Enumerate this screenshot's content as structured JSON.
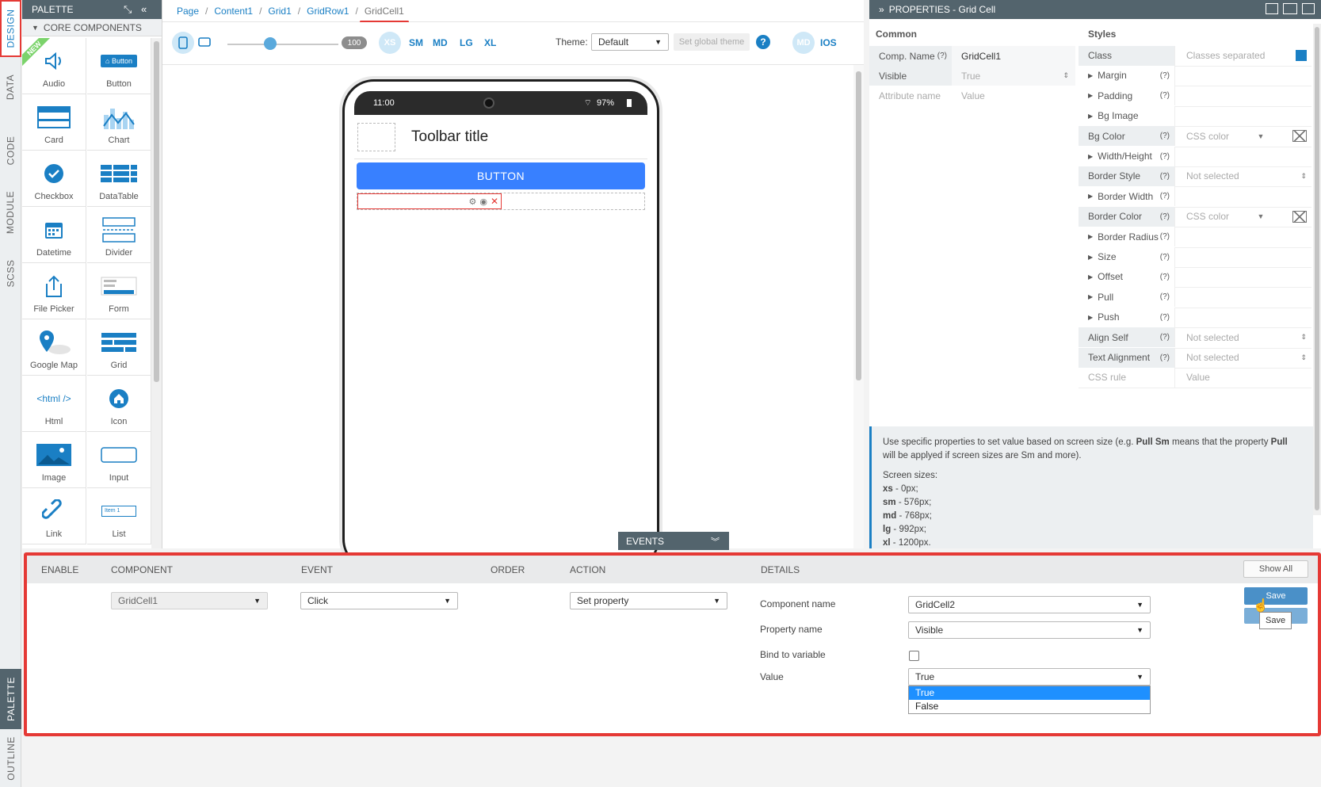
{
  "left_tabs": [
    "DESIGN",
    "DATA",
    "CODE",
    "MODULE",
    "SCSS",
    "PALETTE",
    "OUTLINE"
  ],
  "palette": {
    "title": "PALETTE",
    "section": "CORE COMPONENTS",
    "new_badge": "NEW",
    "items": [
      {
        "label": "Audio",
        "icon": "speaker-icon"
      },
      {
        "label": "Button",
        "icon": "button-icon",
        "mini": "Button"
      },
      {
        "label": "Card",
        "icon": "card-icon"
      },
      {
        "label": "Chart",
        "icon": "chart-icon"
      },
      {
        "label": "Checkbox",
        "icon": "checkbox-icon"
      },
      {
        "label": "DataTable",
        "icon": "datatable-icon"
      },
      {
        "label": "Datetime",
        "icon": "calendar-icon"
      },
      {
        "label": "Divider",
        "icon": "divider-icon"
      },
      {
        "label": "File Picker",
        "icon": "upload-icon"
      },
      {
        "label": "Form",
        "icon": "form-icon"
      },
      {
        "label": "Google Map",
        "icon": "map-pin-icon"
      },
      {
        "label": "Grid",
        "icon": "grid-icon"
      },
      {
        "label": "Html",
        "icon": "html-icon",
        "mini": "<html />"
      },
      {
        "label": "Icon",
        "icon": "home-icon"
      },
      {
        "label": "Image",
        "icon": "image-icon"
      },
      {
        "label": "Input",
        "icon": "input-icon"
      },
      {
        "label": "Link",
        "icon": "link-icon"
      },
      {
        "label": "List",
        "icon": "list-icon",
        "mini": "Item 1"
      }
    ]
  },
  "breadcrumb": [
    "Page",
    "Content1",
    "Grid1",
    "GridRow1",
    "GridCell1"
  ],
  "toolbar": {
    "zoom": "100",
    "sizes": [
      "XS",
      "SM",
      "MD",
      "LG",
      "XL"
    ],
    "theme_label": "Theme:",
    "theme_value": "Default",
    "global_theme_button": "Set global theme",
    "help": "?",
    "md_label": "MD",
    "ios_label": "IOS"
  },
  "phone": {
    "time": "11:00",
    "battery": "97%",
    "toolbar_title": "Toolbar title",
    "button_label": "BUTTON"
  },
  "properties": {
    "title": "PROPERTIES - Grid Cell",
    "common_header": "Common",
    "styles_header": "Styles",
    "common_rows": [
      {
        "label": "Comp. Name",
        "q": "(?)",
        "value": "GridCell1"
      },
      {
        "label": "Visible",
        "q": "",
        "value": "True"
      },
      {
        "label": "Attribute name",
        "q": "",
        "value": "Value"
      }
    ],
    "style_rows": [
      {
        "label": "Class",
        "expand": false,
        "q": "",
        "value": "Classes separated"
      },
      {
        "label": "Margin",
        "expand": true,
        "q": "(?)",
        "value": ""
      },
      {
        "label": "Padding",
        "expand": true,
        "q": "(?)",
        "value": ""
      },
      {
        "label": "Bg Image",
        "expand": true,
        "q": "",
        "value": ""
      },
      {
        "label": "Bg Color",
        "expand": false,
        "q": "(?)",
        "value": "CSS color"
      },
      {
        "label": "Width/Height",
        "expand": true,
        "q": "(?)",
        "value": ""
      },
      {
        "label": "Border Style",
        "expand": false,
        "q": "(?)",
        "value": "Not selected"
      },
      {
        "label": "Border Width",
        "expand": true,
        "q": "(?)",
        "value": ""
      },
      {
        "label": "Border Color",
        "expand": false,
        "q": "(?)",
        "value": "CSS color"
      },
      {
        "label": "Border Radius",
        "expand": true,
        "q": "(?)",
        "value": ""
      },
      {
        "label": "Size",
        "expand": true,
        "q": "(?)",
        "value": ""
      },
      {
        "label": "Offset",
        "expand": true,
        "q": "(?)",
        "value": ""
      },
      {
        "label": "Pull",
        "expand": true,
        "q": "(?)",
        "value": ""
      },
      {
        "label": "Push",
        "expand": true,
        "q": "(?)",
        "value": ""
      },
      {
        "label": "Align Self",
        "expand": false,
        "q": "(?)",
        "value": "Not selected"
      },
      {
        "label": "Text Alignment",
        "expand": false,
        "q": "(?)",
        "value": "Not selected"
      },
      {
        "label": "CSS rule",
        "expand": false,
        "q": "",
        "value": "Value"
      }
    ],
    "help_line1": "Use specific properties to set value based on screen size (e.g. ",
    "help_bold1": "Pull Sm",
    "help_line2": " means that the property ",
    "help_bold2": "Pull",
    "help_line3": " will be applyed if screen sizes are Sm and more).",
    "screen_sizes_label": "Screen sizes:",
    "screen_sizes": [
      {
        "k": "xs",
        "v": " - 0px;"
      },
      {
        "k": "sm",
        "v": " - 576px;"
      },
      {
        "k": "md",
        "v": " - 768px;"
      },
      {
        "k": "lg",
        "v": " - 992px;"
      },
      {
        "k": "xl",
        "v": " - 1200px."
      }
    ]
  },
  "events": {
    "tab_label": "EVENTS",
    "columns": [
      "ENABLE",
      "COMPONENT",
      "EVENT",
      "ORDER",
      "ACTION",
      "DETAILS"
    ],
    "show_all": "Show All",
    "component": "GridCell1",
    "event": "Click",
    "action": "Set property",
    "details": {
      "component_name_label": "Component name",
      "component_name": "GridCell2",
      "property_name_label": "Property name",
      "property_name": "Visible",
      "bind_label": "Bind to variable",
      "value_label": "Value",
      "value": "True",
      "options": [
        "True",
        "False"
      ]
    },
    "save": "Save",
    "tooltip": "Save"
  },
  "colors": {
    "accent": "#1a7fc4",
    "header": "#53646d",
    "highlight": "#e53935",
    "button": "#3880ff"
  }
}
